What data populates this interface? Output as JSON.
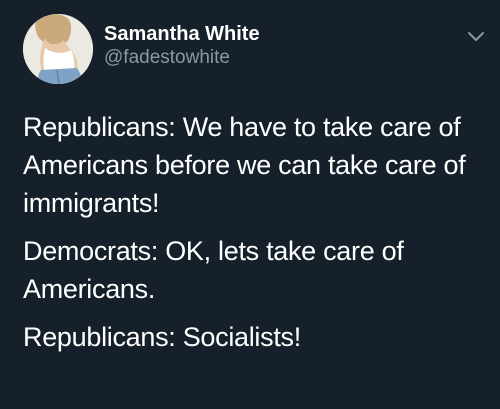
{
  "author": {
    "display_name": "Samantha White",
    "handle": "@fadestowhite"
  },
  "icons": {
    "avatar": "profile-photo",
    "menu": "chevron-down-icon"
  },
  "colors": {
    "background": "#15202b",
    "text": "#ffffff",
    "secondary_text": "#8899a6"
  },
  "tweet": {
    "paragraphs": [
      "Republicans: We have to take care of Americans before we can take care of immigrants!",
      "Democrats: OK, lets take care of Americans.",
      "Republicans: Socialists!"
    ]
  }
}
